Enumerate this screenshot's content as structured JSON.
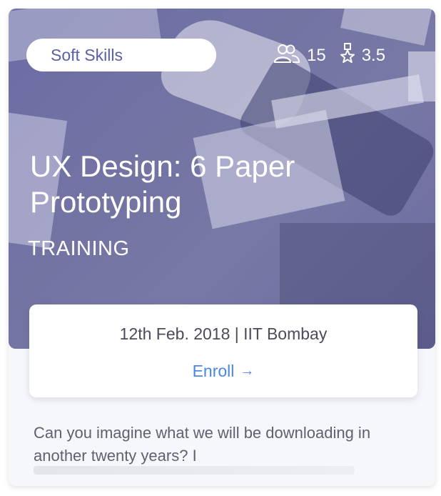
{
  "card": {
    "category": "Soft Skills",
    "participants": "15",
    "rating": "3.5",
    "title": "UX Design: 6 Paper Prototyping",
    "type": "TRAINING",
    "event_info": "12th Feb. 2018 | IIT Bombay",
    "enroll_label": "Enroll",
    "enroll_arrow": "→",
    "description": "Can you imagine what we will be downloading in another twenty years? I"
  },
  "icons": {
    "participants": "users-icon",
    "rating": "award-star-icon",
    "enroll": "arrow-right-icon"
  },
  "colors": {
    "overlay": "#7678b2",
    "accent": "#4a88e0",
    "pill_text": "#5a5fa8",
    "card_bg": "#f6f7fb"
  }
}
